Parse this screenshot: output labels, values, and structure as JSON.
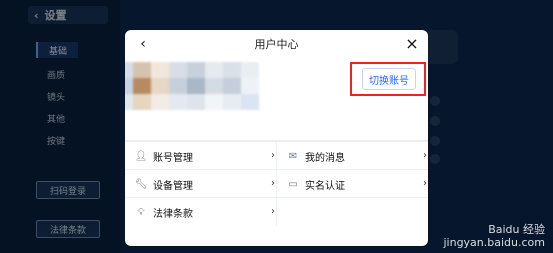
{
  "background": {
    "top_bar_title": "设置",
    "sidebar_items": [
      "基础",
      "画质",
      "镜头",
      "其他",
      "按键"
    ],
    "left_buttons": [
      "扫码登录",
      "法律条款"
    ]
  },
  "modal": {
    "title": "用户中心",
    "switch_account_label": "切换账号",
    "menu": [
      {
        "left": {
          "icon": "user-icon",
          "label": "账号管理"
        },
        "right": {
          "icon": "message-icon",
          "label": "我的消息"
        }
      },
      {
        "left": {
          "icon": "wrench-icon",
          "label": "设备管理"
        },
        "right": {
          "icon": "id-card-icon",
          "label": "实名认证"
        }
      },
      {
        "left": {
          "icon": "bulb-icon",
          "label": "法律条款"
        },
        "right": {
          "icon": "",
          "label": ""
        }
      }
    ]
  },
  "watermark": {
    "line1": "Baidu 经验",
    "line2": "jingyan.baidu.com"
  }
}
